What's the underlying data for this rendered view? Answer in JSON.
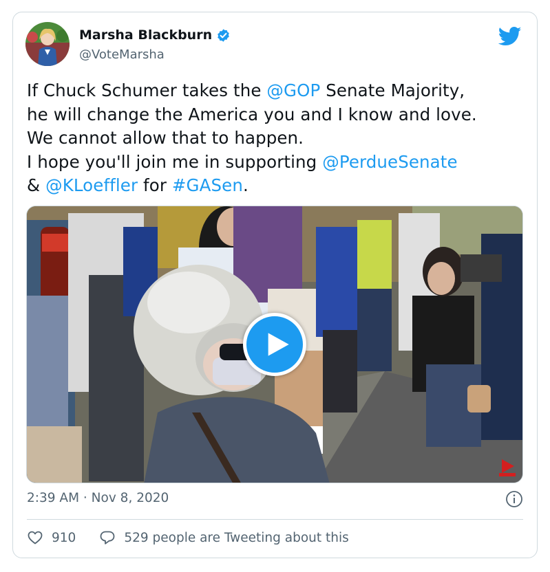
{
  "author": {
    "display_name": "Marsha Blackburn",
    "handle": "@VoteMarsha",
    "avatar_icon": "avatar",
    "verified_icon": "verified-badge-icon",
    "verified_color": "#1d9bf0"
  },
  "brand": {
    "icon": "twitter-bird-icon",
    "color": "#1d9bf0"
  },
  "tweet": {
    "line1_pre": "If Chuck Schumer takes the ",
    "line1_mention": "@GOP",
    "line1_post": " Senate Majority,",
    "line2": "he will change the America you and I know and love.",
    "line3": "We cannot allow that to happen.",
    "line4_pre": "I hope you'll join me in supporting ",
    "line4_mention": "@PerdueSenate",
    "line5_pre": "& ",
    "line5_mention": "@KLoeffler",
    "line5_mid": " for ",
    "line5_hashtag": "#GASen",
    "line5_post": "."
  },
  "media": {
    "type": "video",
    "play_icon": "play-icon"
  },
  "timestamp": "2:39 AM · Nov 8, 2020",
  "info_icon": "info-icon",
  "actions": {
    "likes_count": "910",
    "like_icon": "heart-icon",
    "reply_label": "529 people are Tweeting about this",
    "reply_icon": "speech-bubble-icon"
  },
  "colors": {
    "link": "#1d9bf0",
    "secondary_text": "#536471",
    "border": "#cfd9de"
  }
}
